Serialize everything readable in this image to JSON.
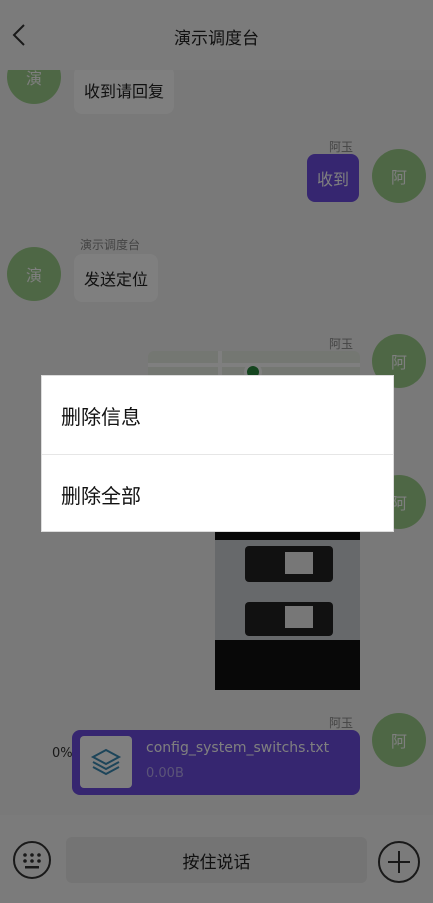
{
  "header": {
    "title": "演示调度台"
  },
  "messages": {
    "m1": {
      "avatar": "演",
      "text": "收到请回复"
    },
    "m2": {
      "sender": "阿玉",
      "avatar": "阿",
      "text": "收到"
    },
    "m3": {
      "sender": "演示调度台",
      "avatar": "演",
      "text": "发送定位"
    },
    "m4": {
      "sender": "阿玉",
      "avatar": "阿"
    },
    "m5": {
      "avatar": "阿"
    },
    "m6": {
      "sender": "阿玉",
      "avatar": "阿",
      "file_name": "config_system_switchs.txt",
      "file_size": "0.00B",
      "progress": "0%"
    }
  },
  "bottom": {
    "talk_label": "按住说话"
  },
  "dialog": {
    "items": [
      "删除信息",
      "删除全部"
    ]
  },
  "colors": {
    "accent": "#6c4ce0",
    "avatar": "#9ccf8a"
  }
}
